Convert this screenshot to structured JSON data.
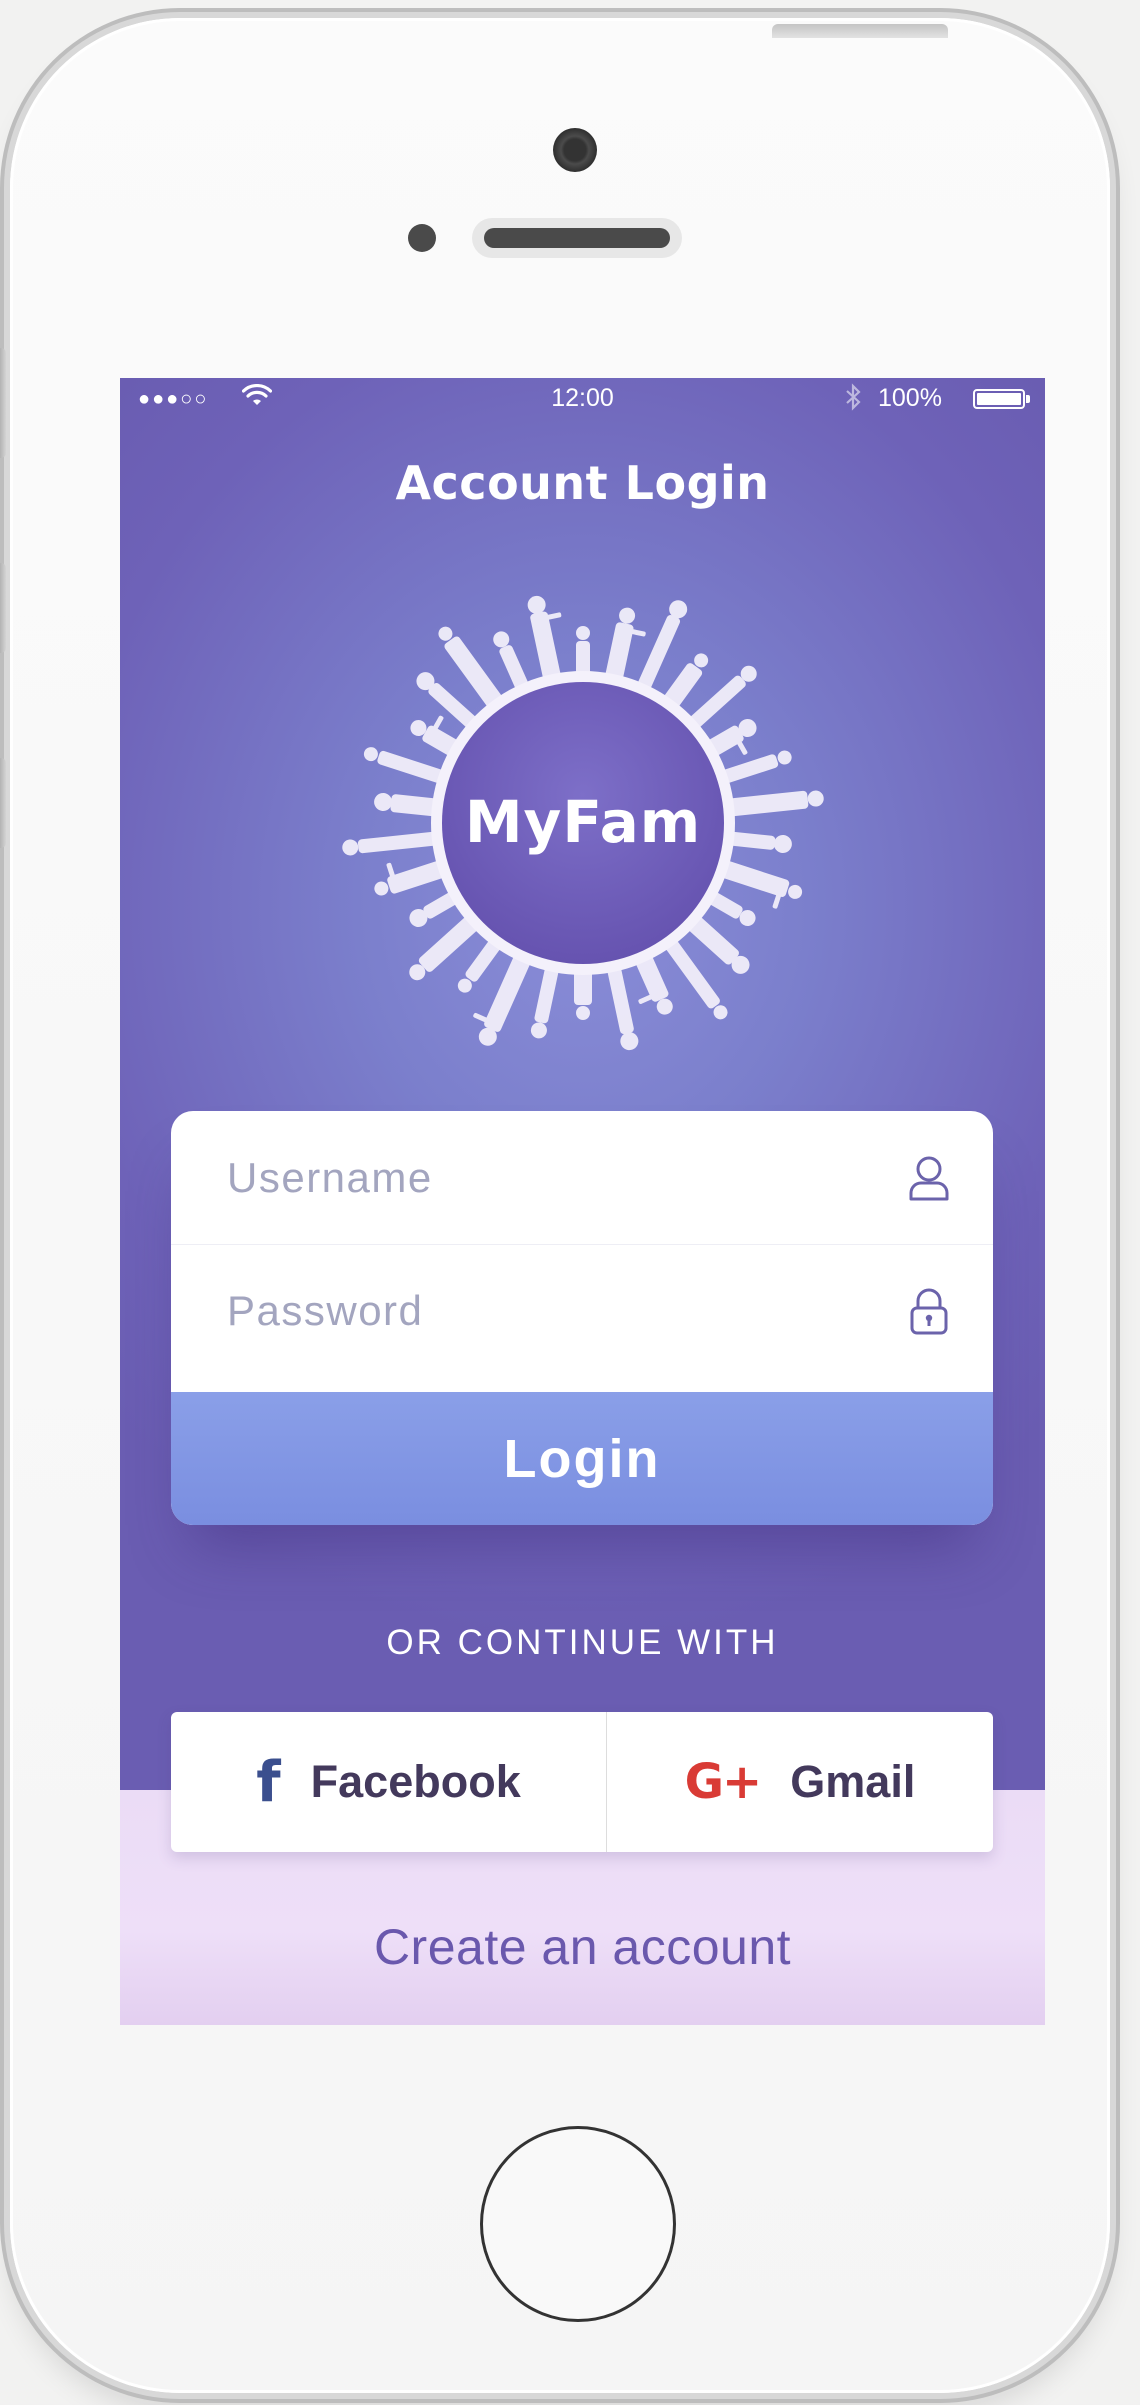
{
  "status_bar": {
    "signal": "●●●○○",
    "wifi_icon": "wifi-icon",
    "time": "12:00",
    "bluetooth_icon": "bluetooth-icon",
    "battery_percent": "100%",
    "battery_level": 1.0
  },
  "header": {
    "title": "Account Login"
  },
  "logo": {
    "text": "MyFam"
  },
  "login_form": {
    "username": {
      "placeholder": "Username",
      "value": "",
      "icon": "user-icon"
    },
    "password": {
      "placeholder": "Password",
      "value": "",
      "icon": "lock-icon"
    },
    "login_label": "Login"
  },
  "social": {
    "divider_text": "OR CONTINUE WITH",
    "facebook": {
      "icon_glyph": "f",
      "label": "Facebook"
    },
    "gmail": {
      "icon_glyph": "G+",
      "label": "Gmail"
    }
  },
  "footer": {
    "create_account": "Create an account"
  },
  "colors": {
    "screen_bg": "#6e62b8",
    "login_button": "#7a8ee0",
    "facebook_blue": "#3b4f8e",
    "google_red": "#d93b35",
    "footer_bg": "#eedff8",
    "create_link": "#6a58ad"
  }
}
